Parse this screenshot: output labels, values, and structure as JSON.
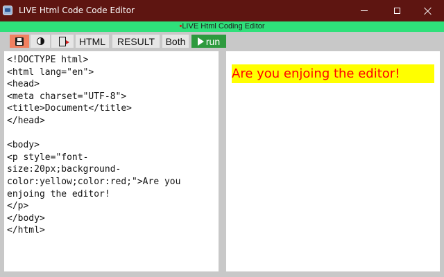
{
  "window": {
    "title": "LIVE Html Code Code Editor",
    "titlebar_color": "#5e1511"
  },
  "banner": {
    "dot": "•",
    "text": "LIVE Html Coding Editor",
    "color": "#2fe07a"
  },
  "toolbar": {
    "save_icon": "save-icon",
    "theme_icon": "contrast-icon",
    "new_icon": "new-document-icon",
    "html_label": "HTML",
    "result_label": "RESULT",
    "both_label": "Both",
    "run_label": "run",
    "run_color": "#2e9a3e",
    "save_color": "#f08060"
  },
  "editor": {
    "code": "<!DOCTYPE html>\n<html lang=\"en\">\n<head>\n<meta charset=\"UTF-8\">\n<title>Document</title>\n</head>\n\n<body>\n<p style=\"font-\nsize:20px;background-\ncolor:yellow;color:red;\">Are you\nenjoing the editor!\n</p>\n</body>\n</html>"
  },
  "result": {
    "paragraph": "Are you enjoing the editor!",
    "background": "#ffff00",
    "color": "#ff0000"
  }
}
